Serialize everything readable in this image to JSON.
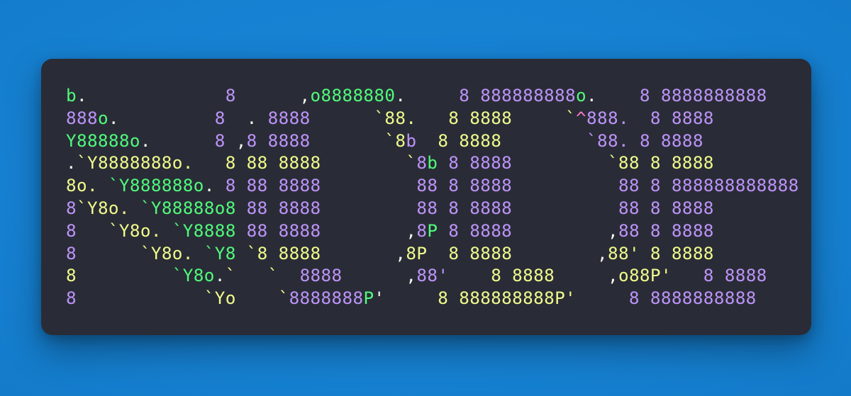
{
  "window": {
    "title": "ascii-art-code-card",
    "background_color": "#1680d1",
    "card_color": "#292c36"
  },
  "palette": {
    "green": "#50fa7b",
    "purple": "#bd93f9",
    "yellow": "#f1fa8c",
    "white": "#f8f8f2",
    "pink": "#ff79c6",
    "background": "#1680d1",
    "card": "#292c36"
  },
  "ascii_art": {
    "description": "figlet-style banner rendered as colored ASCII art",
    "font_size_px": 24,
    "line_count": 10,
    "plain_text": [
      "b.             8        ,o888888o.     8 888888888o.   8 8888888888",
      "888o.          8     . 8888     `88.   8 8888    `^888. 8 8888",
      "Y88888o.       8    ,8 8888       `8b  8 8888        `88.8 8888",
      ".`Y8888888o.   8 88 8888        `8b 8 8888         `88 8 8888",
      "8o. `Y888888o. 8 88 8888         88 8 8888          88 8 888888888888",
      "8`Y8o. `Y88888o8 88 8888         88 8 8888          88 8 8888",
      "8   `Y8o. `Y8888 88 8888        ,8P 8 8888         ,88 8 8888",
      "8      `Y8o. `Y8 `8 8888       ,8P  8 8888        ,88' 8 8888",
      "8         `Y8o.`   8888      ,88'   8 8888    ,o88P'   8 8888",
      "8            `Yo    `8888888P'      8 888888888P'      8 8888888888"
    ],
    "lines": [
      [
        {
          "t": "b",
          "c": "green"
        },
        {
          "t": ".",
          "c": "white"
        },
        {
          "t": "             ",
          "c": "white"
        },
        {
          "t": "8",
          "c": "purple"
        },
        {
          "t": "      ",
          "c": "white"
        },
        {
          "t": ",",
          "c": "white"
        },
        {
          "t": "o8888880",
          "c": "green"
        },
        {
          "t": ".",
          "c": "white"
        },
        {
          "t": "     ",
          "c": "white"
        },
        {
          "t": "8 888888888",
          "c": "purple"
        },
        {
          "t": "o",
          "c": "green"
        },
        {
          "t": ".",
          "c": "white"
        },
        {
          "t": "    ",
          "c": "white"
        },
        {
          "t": "8 8888888888",
          "c": "purple"
        }
      ],
      [
        {
          "t": "888",
          "c": "purple"
        },
        {
          "t": "o",
          "c": "green"
        },
        {
          "t": ".",
          "c": "white"
        },
        {
          "t": "         ",
          "c": "white"
        },
        {
          "t": "8",
          "c": "purple"
        },
        {
          "t": "  ",
          "c": "white"
        },
        {
          "t": ".",
          "c": "white"
        },
        {
          "t": " ",
          "c": "white"
        },
        {
          "t": "8888",
          "c": "purple"
        },
        {
          "t": "      ",
          "c": "white"
        },
        {
          "t": "`88",
          "c": "yellow"
        },
        {
          "t": ".",
          "c": "yellow"
        },
        {
          "t": "   ",
          "c": "white"
        },
        {
          "t": "8 8888",
          "c": "yellow"
        },
        {
          "t": "     ",
          "c": "white"
        },
        {
          "t": "`",
          "c": "yellow"
        },
        {
          "t": "^",
          "c": "pink"
        },
        {
          "t": "888",
          "c": "purple"
        },
        {
          "t": ".",
          "c": "purple"
        },
        {
          "t": "  ",
          "c": "white"
        },
        {
          "t": "8 8888",
          "c": "purple"
        }
      ],
      [
        {
          "t": "Y88888o",
          "c": "green"
        },
        {
          "t": ".",
          "c": "white"
        },
        {
          "t": "      ",
          "c": "white"
        },
        {
          "t": "8",
          "c": "purple"
        },
        {
          "t": " ",
          "c": "white"
        },
        {
          "t": ",",
          "c": "white"
        },
        {
          "t": "8",
          "c": "purple"
        },
        {
          "t": " ",
          "c": "white"
        },
        {
          "t": "8888",
          "c": "purple"
        },
        {
          "t": "       ",
          "c": "white"
        },
        {
          "t": "`",
          "c": "yellow"
        },
        {
          "t": "8",
          "c": "yellow"
        },
        {
          "t": "b",
          "c": "purple"
        },
        {
          "t": "  ",
          "c": "white"
        },
        {
          "t": "8 8888",
          "c": "yellow"
        },
        {
          "t": "        ",
          "c": "white"
        },
        {
          "t": "`88",
          "c": "purple"
        },
        {
          "t": ".",
          "c": "purple"
        },
        {
          "t": " ",
          "c": "white"
        },
        {
          "t": "8 8888",
          "c": "purple"
        }
      ],
      [
        {
          "t": ".",
          "c": "white"
        },
        {
          "t": "`Y8888888o",
          "c": "yellow"
        },
        {
          "t": ".",
          "c": "yellow"
        },
        {
          "t": "   ",
          "c": "white"
        },
        {
          "t": "8 88 8888",
          "c": "yellow"
        },
        {
          "t": "        ",
          "c": "white"
        },
        {
          "t": "`",
          "c": "yellow"
        },
        {
          "t": "8",
          "c": "purple"
        },
        {
          "t": "b",
          "c": "green"
        },
        {
          "t": " ",
          "c": "white"
        },
        {
          "t": "8 8888",
          "c": "purple"
        },
        {
          "t": "         ",
          "c": "white"
        },
        {
          "t": "`88",
          "c": "yellow"
        },
        {
          "t": " ",
          "c": "white"
        },
        {
          "t": "8 8888",
          "c": "yellow"
        }
      ],
      [
        {
          "t": "8o",
          "c": "yellow"
        },
        {
          "t": ".",
          "c": "yellow"
        },
        {
          "t": " ",
          "c": "white"
        },
        {
          "t": "`Y888888o",
          "c": "green"
        },
        {
          "t": ".",
          "c": "white"
        },
        {
          "t": " ",
          "c": "white"
        },
        {
          "t": "8 88 8888",
          "c": "purple"
        },
        {
          "t": "         ",
          "c": "white"
        },
        {
          "t": "88",
          "c": "purple"
        },
        {
          "t": " ",
          "c": "white"
        },
        {
          "t": "8 8888",
          "c": "purple"
        },
        {
          "t": "          ",
          "c": "white"
        },
        {
          "t": "88",
          "c": "purple"
        },
        {
          "t": " ",
          "c": "white"
        },
        {
          "t": "8 888888888888",
          "c": "purple"
        }
      ],
      [
        {
          "t": "8",
          "c": "purple"
        },
        {
          "t": "`Y8o",
          "c": "yellow"
        },
        {
          "t": ".",
          "c": "yellow"
        },
        {
          "t": " ",
          "c": "white"
        },
        {
          "t": "`Y88888o8",
          "c": "green"
        },
        {
          "t": " ",
          "c": "white"
        },
        {
          "t": "88 8888",
          "c": "purple"
        },
        {
          "t": "         ",
          "c": "white"
        },
        {
          "t": "88",
          "c": "purple"
        },
        {
          "t": " ",
          "c": "white"
        },
        {
          "t": "8 8888",
          "c": "purple"
        },
        {
          "t": "          ",
          "c": "white"
        },
        {
          "t": "88",
          "c": "purple"
        },
        {
          "t": " ",
          "c": "white"
        },
        {
          "t": "8 8888",
          "c": "purple"
        }
      ],
      [
        {
          "t": "8",
          "c": "purple"
        },
        {
          "t": "   ",
          "c": "white"
        },
        {
          "t": "`Y8o",
          "c": "yellow"
        },
        {
          "t": ".",
          "c": "yellow"
        },
        {
          "t": " ",
          "c": "white"
        },
        {
          "t": "`Y8888",
          "c": "green"
        },
        {
          "t": " ",
          "c": "white"
        },
        {
          "t": "88 8888",
          "c": "purple"
        },
        {
          "t": "        ",
          "c": "white"
        },
        {
          "t": ",",
          "c": "white"
        },
        {
          "t": "8",
          "c": "purple"
        },
        {
          "t": "P",
          "c": "green"
        },
        {
          "t": " ",
          "c": "white"
        },
        {
          "t": "8 8888",
          "c": "purple"
        },
        {
          "t": "         ",
          "c": "white"
        },
        {
          "t": ",",
          "c": "white"
        },
        {
          "t": "88",
          "c": "purple"
        },
        {
          "t": " ",
          "c": "white"
        },
        {
          "t": "8 8888",
          "c": "purple"
        }
      ],
      [
        {
          "t": "8",
          "c": "purple"
        },
        {
          "t": "      ",
          "c": "white"
        },
        {
          "t": "`Y8o",
          "c": "yellow"
        },
        {
          "t": ".",
          "c": "yellow"
        },
        {
          "t": " ",
          "c": "white"
        },
        {
          "t": "`Y8",
          "c": "green"
        },
        {
          "t": " ",
          "c": "white"
        },
        {
          "t": "`8 8888",
          "c": "yellow"
        },
        {
          "t": "       ",
          "c": "white"
        },
        {
          "t": ",",
          "c": "white"
        },
        {
          "t": "8P",
          "c": "yellow"
        },
        {
          "t": "  ",
          "c": "white"
        },
        {
          "t": "8 8888",
          "c": "yellow"
        },
        {
          "t": "        ",
          "c": "white"
        },
        {
          "t": ",",
          "c": "white"
        },
        {
          "t": "88'",
          "c": "yellow"
        },
        {
          "t": " ",
          "c": "white"
        },
        {
          "t": "8 8888",
          "c": "yellow"
        }
      ],
      [
        {
          "t": "8",
          "c": "yellow"
        },
        {
          "t": "         ",
          "c": "white"
        },
        {
          "t": "`Y8o",
          "c": "green"
        },
        {
          "t": ".",
          "c": "white"
        },
        {
          "t": "`",
          "c": "yellow"
        },
        {
          "t": "   ",
          "c": "white"
        },
        {
          "t": "`",
          "c": "yellow"
        },
        {
          "t": "  ",
          "c": "white"
        },
        {
          "t": "8888",
          "c": "purple"
        },
        {
          "t": "      ",
          "c": "white"
        },
        {
          "t": ",",
          "c": "white"
        },
        {
          "t": "88'",
          "c": "purple"
        },
        {
          "t": "    ",
          "c": "white"
        },
        {
          "t": "8 8888",
          "c": "yellow"
        },
        {
          "t": "     ",
          "c": "white"
        },
        {
          "t": ",",
          "c": "white"
        },
        {
          "t": "o88P'",
          "c": "yellow"
        },
        {
          "t": "   ",
          "c": "white"
        },
        {
          "t": "8 8888",
          "c": "purple"
        }
      ],
      [
        {
          "t": "8",
          "c": "purple"
        },
        {
          "t": "            ",
          "c": "white"
        },
        {
          "t": "`Yo",
          "c": "yellow"
        },
        {
          "t": "    ",
          "c": "white"
        },
        {
          "t": "`",
          "c": "yellow"
        },
        {
          "t": "8888888",
          "c": "purple"
        },
        {
          "t": "P",
          "c": "green"
        },
        {
          "t": "'",
          "c": "white"
        },
        {
          "t": "     ",
          "c": "white"
        },
        {
          "t": "8 888888888",
          "c": "yellow"
        },
        {
          "t": "P'",
          "c": "yellow"
        },
        {
          "t": "     ",
          "c": "white"
        },
        {
          "t": "8 8888888888",
          "c": "purple"
        }
      ]
    ]
  }
}
